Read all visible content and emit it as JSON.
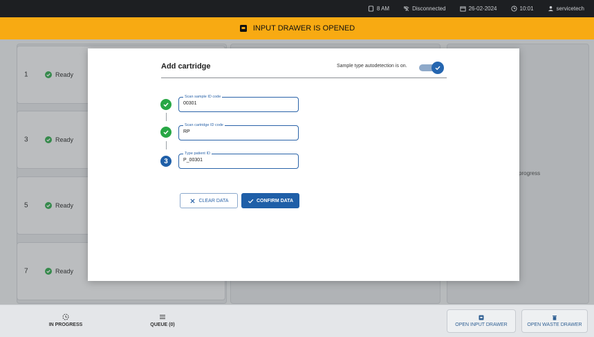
{
  "statusbar": {
    "drawer_time": "8 AM",
    "connection": "Disconnected",
    "date": "26-02-2024",
    "time": "10:01",
    "user": "servicetech"
  },
  "banner": {
    "text": "INPUT DRAWER IS OPENED",
    "color": "#f8aa12"
  },
  "slots": [
    {
      "number": "1",
      "status": "Ready"
    },
    {
      "number": "3",
      "status": "Ready"
    },
    {
      "number": "5",
      "status": "Ready"
    },
    {
      "number": "7",
      "status": "Ready"
    }
  ],
  "in_progress_text": "progress",
  "modal": {
    "title": "Add cartridge",
    "autodetect_label": "Sample type autodetection is on.",
    "autodetect_on": true,
    "steps": [
      {
        "label": "Scan sample ID code",
        "value": "00301",
        "state": "done"
      },
      {
        "label": "Scan cartridge ID code",
        "value": "RP",
        "state": "done"
      },
      {
        "label": "Type patient ID",
        "value": "P_00301",
        "state": "active",
        "number": "3"
      }
    ],
    "clear_label": "CLEAR DATA",
    "confirm_label": "CONFIRM DATA"
  },
  "bottom_nav": {
    "in_progress": "IN PROGRESS",
    "queue": "QUEUE (0)",
    "open_input_drawer": "OPEN INPUT DRAWER",
    "open_waste_drawer": "OPEN WASTE DRAWER"
  },
  "colors": {
    "primary": "#1f5fa8",
    "success": "#28a745",
    "warning": "#f8aa12"
  }
}
